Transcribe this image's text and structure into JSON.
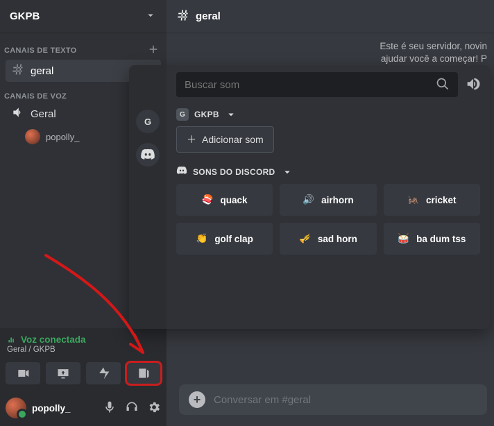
{
  "server": {
    "name": "GKPB"
  },
  "textSection": {
    "label": "CANAIS DE TEXTO"
  },
  "voiceSection": {
    "label": "CANAIS DE VOZ"
  },
  "channels": {
    "text": [
      {
        "name": "geral"
      }
    ],
    "voice": [
      {
        "name": "Geral",
        "users": [
          {
            "name": "popolly_"
          }
        ]
      }
    ]
  },
  "voiceStatus": {
    "state": "Voz conectada",
    "sub": "Geral / GKPB"
  },
  "userBar": {
    "name": "popolly_"
  },
  "mainChannel": {
    "name": "geral"
  },
  "hint": {
    "l1": "Este é seu servidor, novin",
    "l2": "ajudar você a começar! P"
  },
  "messageInput": {
    "placeholder": "Conversar em #geral"
  },
  "soundPanel": {
    "search": {
      "placeholder": "Buscar som"
    },
    "group1": {
      "badge": "G",
      "name": "GKPB"
    },
    "addSound": "Adicionar som",
    "group2": {
      "name": "SONS DO DISCORD"
    },
    "sounds": [
      {
        "emoji": "🍣",
        "label": "quack"
      },
      {
        "emoji": "🔊",
        "label": "airhorn"
      },
      {
        "emoji": "🦗",
        "label": "cricket"
      },
      {
        "emoji": "👏",
        "label": "golf clap"
      },
      {
        "emoji": "🎺",
        "label": "sad horn"
      },
      {
        "emoji": "🥁",
        "label": "ba dum tss"
      }
    ]
  }
}
